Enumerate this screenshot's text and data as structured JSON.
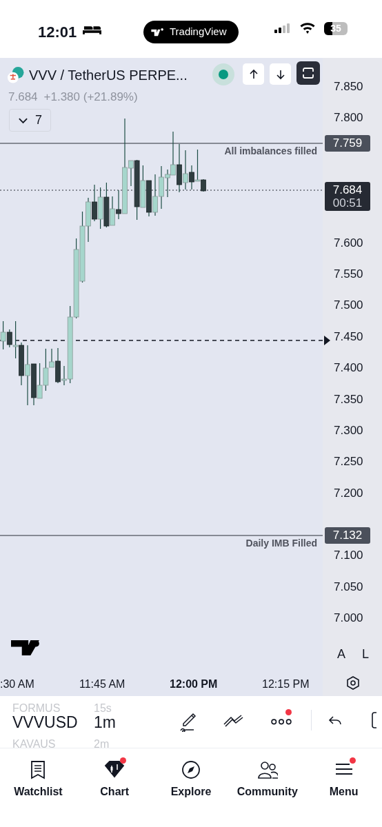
{
  "status_bar": {
    "time": "12:01",
    "app_pill": "TradingView",
    "battery": "35"
  },
  "symbol": {
    "title": "VVV / TetherUS PERPE...",
    "last": "7.684",
    "change": "+1.380 (+21.89%)"
  },
  "indicator_toggle": {
    "expanded": false,
    "count": "7"
  },
  "price_axis": {
    "ticks": [
      "7.850",
      "7.800",
      "7.600",
      "7.550",
      "7.500",
      "7.450",
      "7.400",
      "7.350",
      "7.300",
      "7.250",
      "7.200",
      "7.100",
      "7.050",
      "7.000"
    ]
  },
  "price_labels": [
    {
      "kind": "line",
      "text": "7.759"
    },
    {
      "kind": "current",
      "text": "7.684",
      "countdown": "00:51"
    },
    {
      "kind": "line",
      "text": "7.132"
    }
  ],
  "line_notes": [
    "All imbalances filled",
    "Daily IMB Filled"
  ],
  "scale_buttons": [
    "A",
    "L"
  ],
  "time_axis": [
    {
      "text": ":30 AM",
      "current": false
    },
    {
      "text": "11:45 AM",
      "current": false
    },
    {
      "text": "12:00 PM",
      "current": true
    },
    {
      "text": "12:15 PM",
      "current": false
    }
  ],
  "toolbar": {
    "symbols": [
      {
        "kind": "faded",
        "symbol": "FORMUS",
        "interval": "15s"
      },
      {
        "kind": "current",
        "symbol": "VVVUSD",
        "interval": "1m"
      },
      {
        "kind": "faded",
        "symbol": "KAVAUS",
        "interval": "2m"
      }
    ],
    "more_badge": true
  },
  "tabs": [
    {
      "label": "Watchlist",
      "selected": false,
      "badge": false
    },
    {
      "label": "Chart",
      "selected": true,
      "badge": true
    },
    {
      "label": "Explore",
      "selected": false,
      "badge": false
    },
    {
      "label": "Community",
      "selected": false,
      "badge": false
    },
    {
      "label": "Menu",
      "selected": false,
      "badge": true
    }
  ]
}
